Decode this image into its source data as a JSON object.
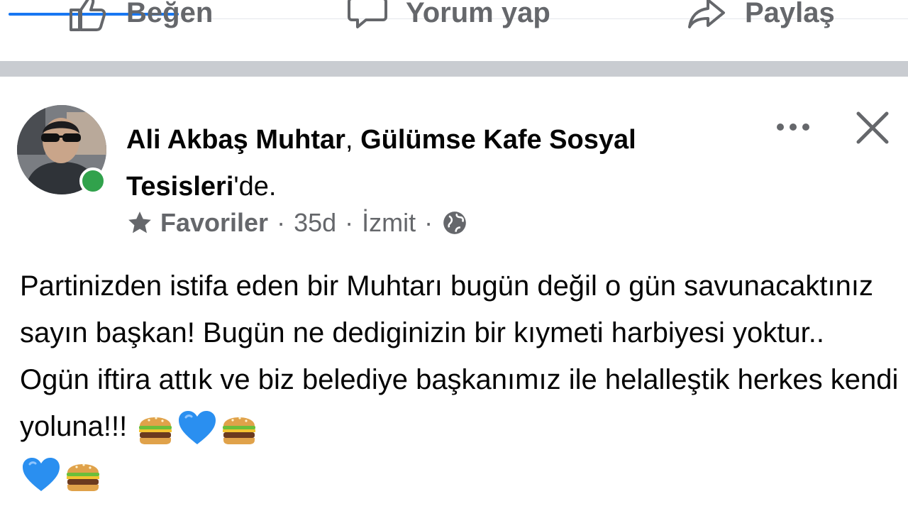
{
  "actions": {
    "like_label": "Beğen",
    "comment_label": "Yorum yap",
    "share_label": "Paylaş"
  },
  "post": {
    "author_name": "Ali Akbaş Muhtar",
    "author_sep": ", ",
    "place": "Gülümse Kafe Sosyal Tesisleri",
    "place_suffix": "'de.",
    "audience": "Favoriler",
    "time": "35d",
    "location": "İzmit",
    "dot": "·",
    "text": "Partinizden istifa eden bir Muhtarı bugün değil o gün savunacaktınız sayın başkan! Bugün ne dediginizin bir kıymeti harbiyesi yoktur.. Ogün iftira attık ve biz belediye başkanımız ile helalleştik herkes kendi yoluna!!! ",
    "emojis": [
      "burger",
      "blue-heart",
      "burger",
      "blue-heart",
      "burger"
    ]
  },
  "colors": {
    "accent": "#1877f2",
    "secondary_text": "#65676b",
    "online": "#31a24c",
    "divider": "#c9ccd1"
  },
  "icons": [
    "like-icon",
    "comment-icon",
    "share-icon",
    "star-icon",
    "globe-icon",
    "more-icon",
    "close-icon"
  ]
}
